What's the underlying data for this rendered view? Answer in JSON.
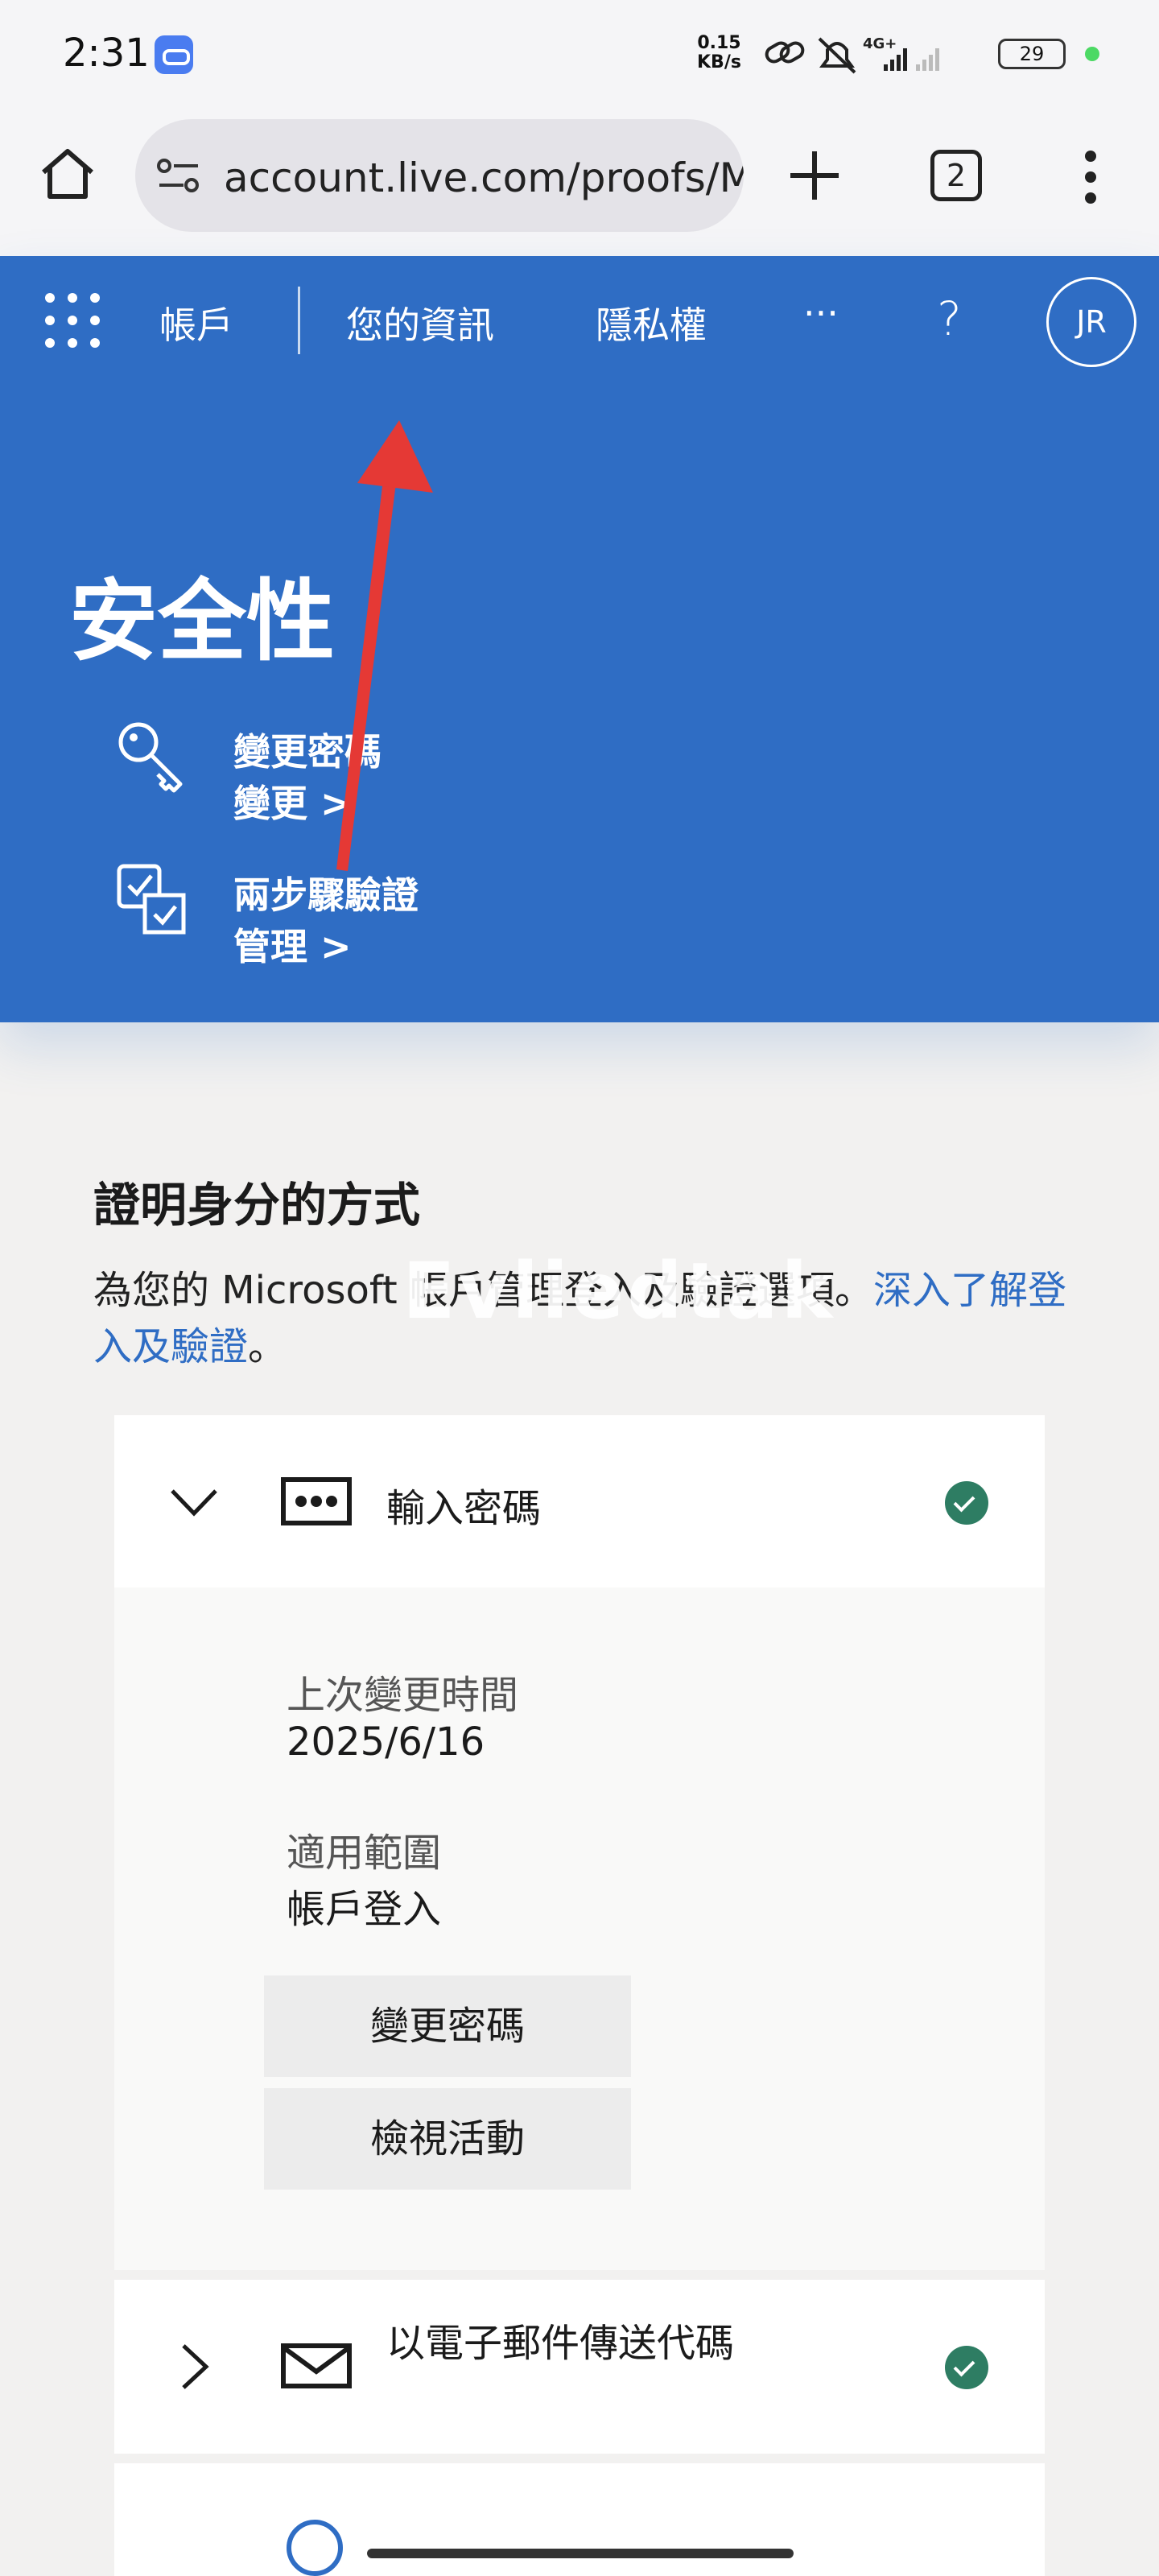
{
  "status_bar": {
    "time": "2:31",
    "speed_value": "0.15",
    "speed_unit": "KB/s",
    "network": "4G+",
    "battery": "29"
  },
  "browser": {
    "url": "account.live.com/proofs/Manage",
    "tab_count": "2"
  },
  "nav": {
    "account": "帳戶",
    "your_info": "您的資訊",
    "privacy": "隱私權",
    "more": "···",
    "help": "?",
    "avatar_initials": "JR"
  },
  "hero": {
    "title": "安全性",
    "links": [
      {
        "title": "變更密碼",
        "action": "變更 >"
      },
      {
        "title": "兩步驟驗證",
        "action": "管理 >"
      }
    ]
  },
  "section": {
    "title": "證明身分的方式",
    "desc_prefix": "為您的 Microsoft 帳戶管理登入及驗證選項。",
    "desc_link": "深入了解登入及驗證",
    "desc_suffix": "。",
    "watermark": "Evliedtak"
  },
  "methods": [
    {
      "label": "輸入密碼",
      "expanded": true,
      "last_changed_label": "上次變更時間",
      "last_changed_value": "2025/6/16",
      "scope_label": "適用範圍",
      "scope_value": "帳戶登入",
      "buttons": [
        "變更密碼",
        "檢視活動"
      ]
    },
    {
      "label": "以電子郵件傳送代碼",
      "expanded": false
    }
  ],
  "colors": {
    "brand_blue": "#2f6dc4",
    "check_green": "#2e7d63",
    "annotation_red": "#e53935"
  }
}
